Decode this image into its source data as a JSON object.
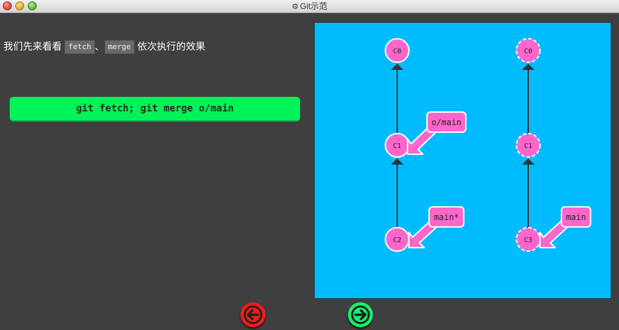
{
  "window": {
    "title": "Git示范"
  },
  "intro": {
    "before": "我们先来看看",
    "code_fetch": "fetch",
    "separator": "、",
    "code_merge": "merge",
    "after": "依次执行的效果"
  },
  "command": {
    "label": "git fetch; git merge o/main"
  },
  "colors": {
    "panel_bg": "#00bcff",
    "commit_fill": "#ff66cc",
    "branch_fill": "#ff66cc",
    "command_bg": "#00f25a",
    "back_button": "#ff1a1a",
    "forward_button": "#17f26a"
  },
  "before_tree": {
    "commits": [
      {
        "id": "C0"
      },
      {
        "id": "C1"
      },
      {
        "id": "C2"
      }
    ],
    "branches": [
      {
        "name": "o/main",
        "target": "C1"
      },
      {
        "name": "main*",
        "target": "C2"
      }
    ]
  },
  "after_tree": {
    "commits": [
      {
        "id": "C0"
      },
      {
        "id": "C1"
      },
      {
        "id": "C3"
      }
    ],
    "branches": [
      {
        "name": "main",
        "target": "C3"
      }
    ]
  },
  "nav": {
    "back_icon": "arrow-left-icon",
    "forward_icon": "arrow-right-icon"
  }
}
